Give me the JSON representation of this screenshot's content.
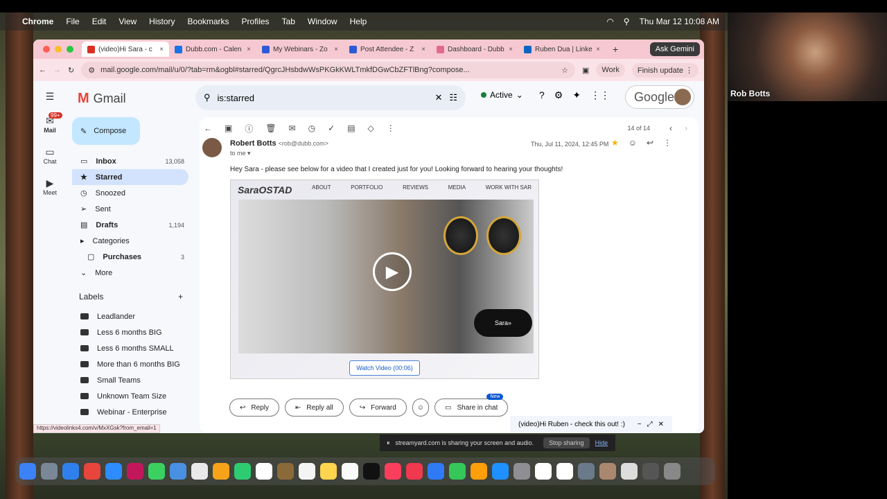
{
  "menubar": {
    "app": "Chrome",
    "items": [
      "File",
      "Edit",
      "View",
      "History",
      "Bookmarks",
      "Profiles",
      "Tab",
      "Window",
      "Help"
    ],
    "clock": "Thu Mar 12  10:08 AM"
  },
  "camera": {
    "name": "Rob Botts"
  },
  "tabs": [
    {
      "label": "(video)Hi Sara - c",
      "color": "#d93025"
    },
    {
      "label": "Dubb.com - Calen",
      "color": "#1a73e8"
    },
    {
      "label": "My Webinars - Zo",
      "color": "#2d5bd7"
    },
    {
      "label": "Post Attendee - Z",
      "color": "#2d5bd7"
    },
    {
      "label": "Dashboard - Dubb",
      "color": "#e36b8a"
    },
    {
      "label": "Ruben Dua | Linke",
      "color": "#0a66c2"
    }
  ],
  "ask_gemini": "Ask Gemini",
  "address": {
    "url": "mail.google.com/mail/u/0/?tab=rm&ogbl#starred/QgrcJHsbdwWsPKGkKWLTmkfDGwCbZFTlBng?compose...",
    "profile": "Work",
    "finish_update": "Finish update"
  },
  "gmail": {
    "rail": [
      {
        "label": "Mail",
        "badge": "99+"
      },
      {
        "label": "Chat"
      },
      {
        "label": "Meet"
      }
    ],
    "logo": "Gmail",
    "search_value": "is:starred",
    "status": "Active",
    "google": "Google",
    "compose": "Compose",
    "nav": [
      {
        "label": "Inbox",
        "count": "13,058",
        "icon": "inbox-icon",
        "glyph": "▭"
      },
      {
        "label": "Starred",
        "count": "",
        "icon": "star-icon",
        "glyph": "★"
      },
      {
        "label": "Snoozed",
        "count": "",
        "icon": "clock-icon",
        "glyph": "◷"
      },
      {
        "label": "Sent",
        "count": "",
        "icon": "send-icon",
        "glyph": "➢"
      },
      {
        "label": "Drafts",
        "count": "1,194",
        "icon": "draft-icon",
        "glyph": "▤"
      },
      {
        "label": "Categories",
        "count": "",
        "icon": "label-icon",
        "glyph": "▸"
      },
      {
        "label": "Purchases",
        "count": "3",
        "icon": "cart-icon",
        "glyph": "▢"
      },
      {
        "label": "More",
        "count": "",
        "icon": "chevron-down-icon",
        "glyph": "⌄"
      }
    ],
    "labels_title": "Labels",
    "labels": [
      "Leadlander",
      "Less 6 months BIG",
      "Less 6 months SMALL",
      "More than 6 months BIG",
      "Small Teams",
      "Unknown Team Size",
      "Webinar - Enterprise"
    ],
    "count": "14 of 14",
    "message": {
      "sender": "Robert Botts",
      "email": "<rob@dubb.com>",
      "to": "to me",
      "date": "Thu, Jul 11, 2024, 12:45 PM",
      "body": "Hey Sara - please see below for a video that I created just for you! Looking forward to hearing your thoughts!",
      "video_brand": "SaraOSTAD",
      "video_nav": [
        "ABOUT",
        "PORTFOLIO",
        "REVIEWS",
        "MEDIA",
        "WORK WITH SAR"
      ],
      "video_button": "Sara",
      "watch": "Watch Video (00:06)"
    },
    "actions": {
      "reply": "Reply",
      "reply_all": "Reply all",
      "forward": "Forward",
      "share": "Share in chat",
      "new": "New"
    },
    "minichat": "(video)Hi Ruben - check this out! :)"
  },
  "status_url": "https://videolinks4.com/v/MxXGsk?from_email=1",
  "share": {
    "text": "streamyard.com is sharing your screen and audio.",
    "stop": "Stop sharing",
    "hide": "Hide"
  }
}
